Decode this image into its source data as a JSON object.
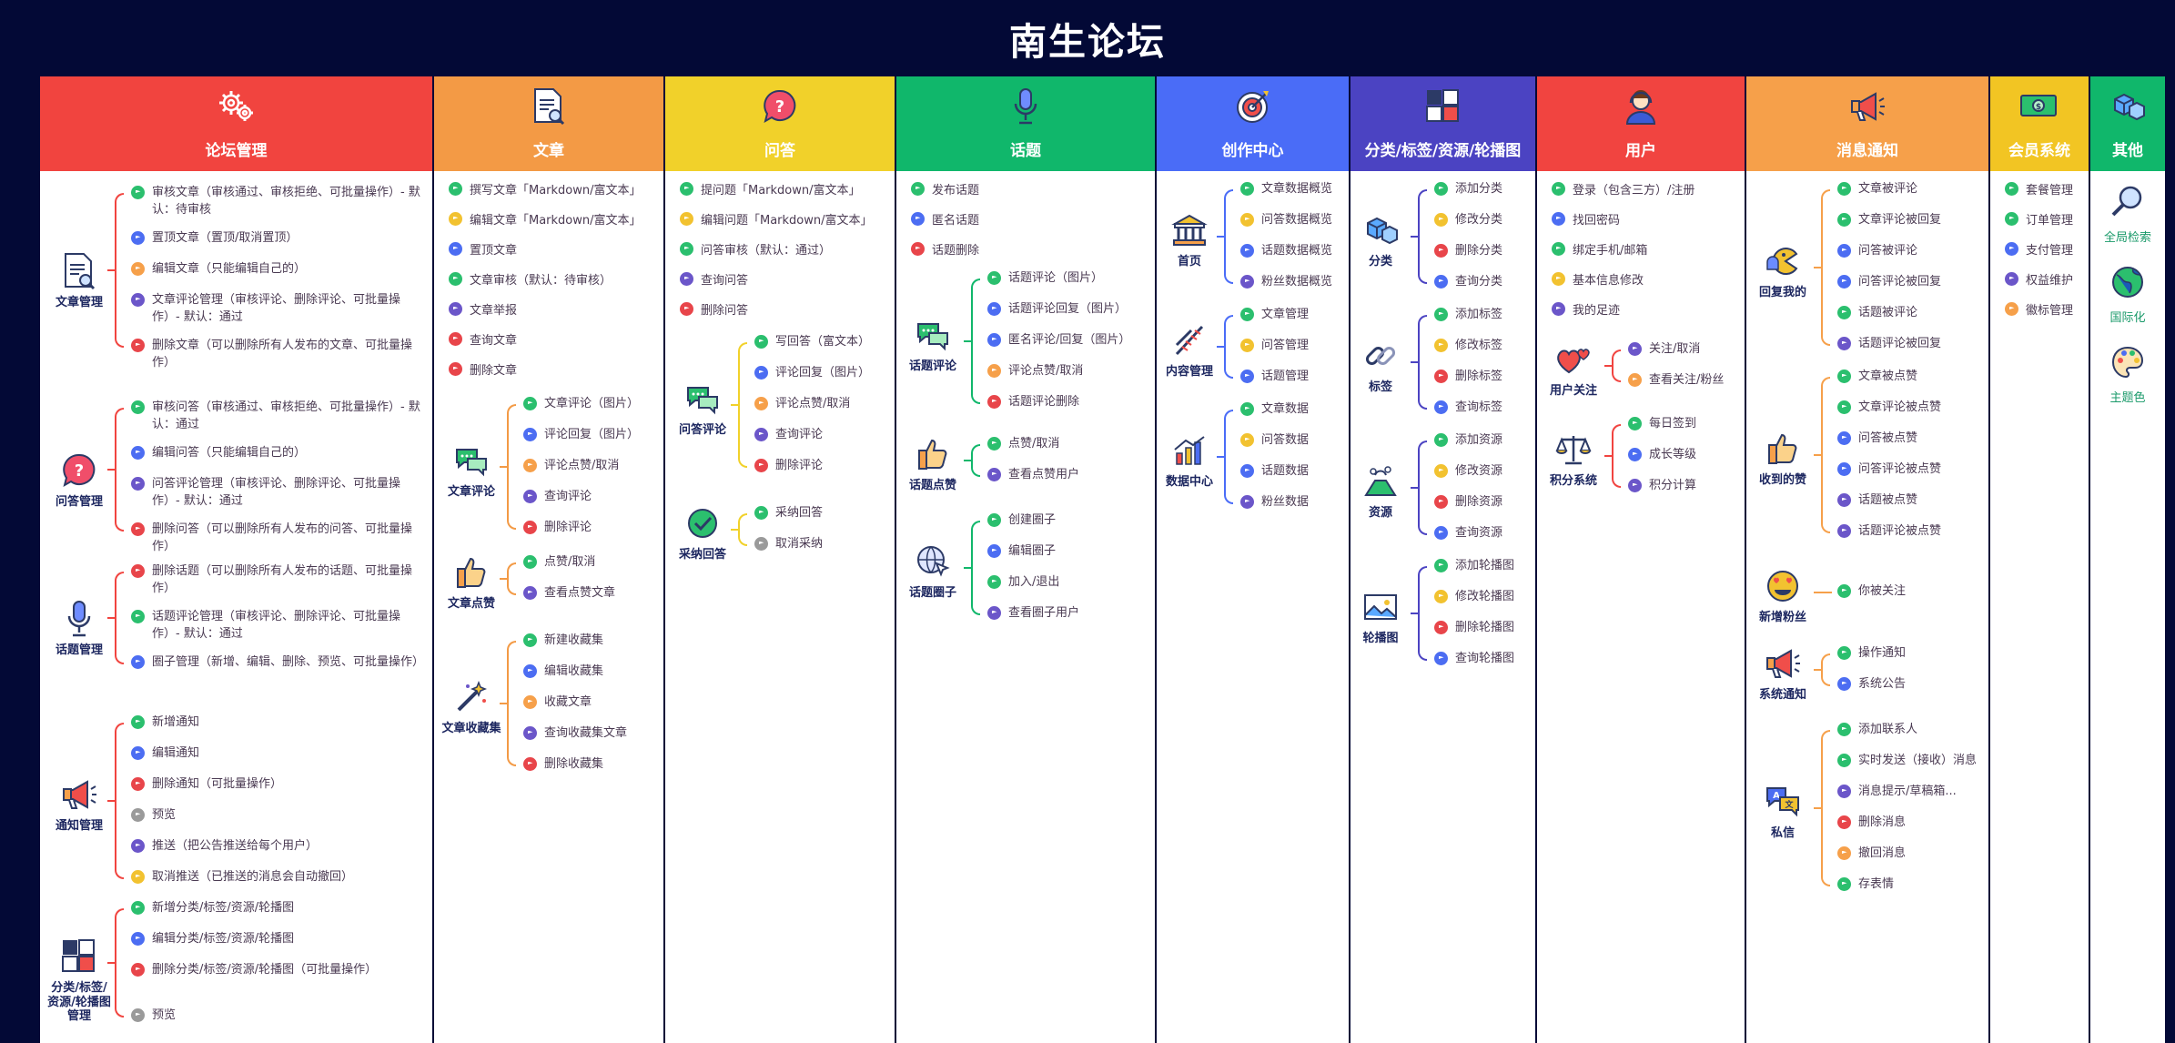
{
  "title": "南生论坛",
  "colors": {
    "bg": "#030936",
    "green": "#2bbf6e",
    "blue": "#4c6df2",
    "orange": "#f6a04a",
    "yellow": "#f2c230",
    "red": "#e8454a",
    "purple": "#6b56c9",
    "gray": "#9a9a9a"
  },
  "columns": [
    {
      "id": "forum",
      "title": "论坛管理",
      "color": "#f1443f",
      "icon": "gears-icon",
      "width": 431,
      "groups": [
        {
          "label": "文章管理",
          "icon": "document-search-icon",
          "items": [
            {
              "text": "审核文章（审核通过、审核拒绝、可批量操作）- 默认：待审核",
              "flag": "green"
            },
            {
              "text": "置顶文章（置顶/取消置顶）",
              "flag": "blue"
            },
            {
              "text": "编辑文章（只能编辑自己的）",
              "flag": "orange"
            },
            {
              "text": "文章评论管理（审核评论、删除评论、可批量操作）- 默认：通过",
              "flag": "purple"
            },
            {
              "text": "删除文章（可以删除所有人发布的文章、可批量操作）",
              "flag": "red"
            }
          ]
        },
        {
          "label": "问答管理",
          "icon": "question-bubble-icon",
          "items": [
            {
              "text": "审核问答（审核通过、审核拒绝、可批量操作）- 默认：通过",
              "flag": "green"
            },
            {
              "text": "编辑问答（只能编辑自己的）",
              "flag": "blue"
            },
            {
              "text": "问答评论管理（审核评论、删除评论、可批量操作）- 默认：通过",
              "flag": "purple"
            },
            {
              "text": "删除问答（可以删除所有人发布的问答、可批量操作）",
              "flag": "red"
            }
          ]
        },
        {
          "label": "话题管理",
          "icon": "microphone-icon",
          "items": [
            {
              "text": "删除话题（可以删除所有人发布的话题、可批量操作）",
              "flag": "red"
            },
            {
              "text": "话题评论管理（审核评论、删除评论、可批量操作）- 默认：通过",
              "flag": "green"
            },
            {
              "text": "圈子管理（新增、编辑、删除、预览、可批量操作）",
              "flag": "blue"
            }
          ]
        },
        {
          "label": "通知管理",
          "icon": "megaphone-icon",
          "items": [
            {
              "text": "新增通知",
              "flag": "green"
            },
            {
              "text": "编辑通知",
              "flag": "blue"
            },
            {
              "text": "删除通知（可批量操作）",
              "flag": "red"
            },
            {
              "text": "预览",
              "flag": "gray"
            },
            {
              "text": "推送（把公告推送给每个用户）",
              "flag": "purple"
            },
            {
              "text": "取消推送（已推送的消息会自动撤回）",
              "flag": "yellow"
            }
          ]
        },
        {
          "label": "分类/标签/资源/轮播图管理",
          "icon": "categories-icon",
          "items": [
            {
              "text": "新增分类/标签/资源/轮播图",
              "flag": "green"
            },
            {
              "text": "编辑分类/标签/资源/轮播图",
              "flag": "blue"
            },
            {
              "text": "删除分类/标签/资源/轮播图（可批量操作）",
              "flag": "red"
            },
            {
              "text": "预览",
              "flag": "gray"
            }
          ]
        }
      ]
    },
    {
      "id": "article",
      "title": "文章",
      "color": "#f39a45",
      "icon": "document-search-icon",
      "width": 252,
      "simple": [
        {
          "text": "撰写文章「Markdown/富文本」",
          "flag": "green"
        },
        {
          "text": "编辑文章「Markdown/富文本」",
          "flag": "yellow"
        },
        {
          "text": "置顶文章",
          "flag": "blue"
        },
        {
          "text": "文章审核（默认：待审核）",
          "flag": "green"
        },
        {
          "text": "文章举报",
          "flag": "purple"
        },
        {
          "text": "查询文章",
          "flag": "red"
        },
        {
          "text": "删除文章",
          "flag": "red"
        }
      ],
      "groups": [
        {
          "label": "文章评论",
          "icon": "chat-bubbles-icon",
          "items": [
            {
              "text": "文章评论（图片）",
              "flag": "green"
            },
            {
              "text": "评论回复（图片）",
              "flag": "blue"
            },
            {
              "text": "评论点赞/取消",
              "flag": "orange"
            },
            {
              "text": "查询评论",
              "flag": "purple"
            },
            {
              "text": "删除评论",
              "flag": "red"
            }
          ]
        },
        {
          "label": "文章点赞",
          "icon": "thumbs-up-icon",
          "items": [
            {
              "text": "点赞/取消",
              "flag": "green"
            },
            {
              "text": "查看点赞文章",
              "flag": "purple"
            }
          ]
        },
        {
          "label": "文章收藏集",
          "icon": "magic-wand-icon",
          "items": [
            {
              "text": "新建收藏集",
              "flag": "green"
            },
            {
              "text": "编辑收藏集",
              "flag": "blue"
            },
            {
              "text": "收藏文章",
              "flag": "orange"
            },
            {
              "text": "查询收藏集文章",
              "flag": "purple"
            },
            {
              "text": "删除收藏集",
              "flag": "red"
            }
          ]
        }
      ]
    },
    {
      "id": "qa",
      "title": "问答",
      "color": "#f1d12a",
      "icon": "question-bubble-icon",
      "width": 252,
      "simple": [
        {
          "text": "提问题「Markdown/富文本」",
          "flag": "green"
        },
        {
          "text": "编辑问题「Markdown/富文本」",
          "flag": "yellow"
        },
        {
          "text": "问答审核（默认：通过）",
          "flag": "green"
        },
        {
          "text": "查询问答",
          "flag": "purple"
        },
        {
          "text": "删除问答",
          "flag": "red"
        }
      ],
      "groups": [
        {
          "label": "问答评论",
          "icon": "chat-bubbles-icon",
          "items": [
            {
              "text": "写回答（富文本）",
              "flag": "green"
            },
            {
              "text": "评论回复（图片）",
              "flag": "blue"
            },
            {
              "text": "评论点赞/取消",
              "flag": "orange"
            },
            {
              "text": "查询评论",
              "flag": "purple"
            },
            {
              "text": "删除评论",
              "flag": "red"
            }
          ]
        },
        {
          "label": "采纳回答",
          "icon": "check-circle-icon",
          "items": [
            {
              "text": "采纳回答",
              "flag": "green"
            },
            {
              "text": "取消采纳",
              "flag": "gray"
            }
          ]
        }
      ]
    },
    {
      "id": "topic",
      "title": "话题",
      "color": "#10b76b",
      "icon": "microphone-icon",
      "width": 284,
      "simple": [
        {
          "text": "发布话题",
          "flag": "green"
        },
        {
          "text": "匿名话题",
          "flag": "blue"
        },
        {
          "text": "话题删除",
          "flag": "red"
        }
      ],
      "groups": [
        {
          "label": "话题评论",
          "icon": "chat-bubbles-icon",
          "items": [
            {
              "text": "话题评论（图片）",
              "flag": "green"
            },
            {
              "text": "话题评论回复（图片）",
              "flag": "blue"
            },
            {
              "text": "匿名评论/回复（图片）",
              "flag": "blue"
            },
            {
              "text": "评论点赞/取消",
              "flag": "orange"
            },
            {
              "text": "话题评论删除",
              "flag": "red"
            }
          ]
        },
        {
          "label": "话题点赞",
          "icon": "thumbs-up-icon",
          "items": [
            {
              "text": "点赞/取消",
              "flag": "green"
            },
            {
              "text": "查看点赞用户",
              "flag": "purple"
            }
          ]
        },
        {
          "label": "话题圈子",
          "icon": "globe-cursor-icon",
          "items": [
            {
              "text": "创建圈子",
              "flag": "green"
            },
            {
              "text": "编辑圈子",
              "flag": "blue"
            },
            {
              "text": "加入/退出",
              "flag": "green"
            },
            {
              "text": "查看圈子用户",
              "flag": "purple"
            }
          ]
        }
      ]
    },
    {
      "id": "creator",
      "title": "创作中心",
      "color": "#4a6cf7",
      "icon": "target-icon",
      "width": 211,
      "groups": [
        {
          "label": "首页",
          "icon": "bank-icon",
          "items": [
            {
              "text": "文章数据概览",
              "flag": "green"
            },
            {
              "text": "问答数据概览",
              "flag": "yellow"
            },
            {
              "text": "话题数据概览",
              "flag": "blue"
            },
            {
              "text": "粉丝数据概览",
              "flag": "purple"
            }
          ]
        },
        {
          "label": "内容管理",
          "icon": "dna-icon",
          "items": [
            {
              "text": "文章管理",
              "flag": "green"
            },
            {
              "text": "问答管理",
              "flag": "yellow"
            },
            {
              "text": "话题管理",
              "flag": "blue"
            }
          ]
        },
        {
          "label": "数据中心",
          "icon": "bar-chart-icon",
          "items": [
            {
              "text": "文章数据",
              "flag": "green"
            },
            {
              "text": "问答数据",
              "flag": "yellow"
            },
            {
              "text": "话题数据",
              "flag": "blue"
            },
            {
              "text": "粉丝数据",
              "flag": "purple"
            }
          ]
        }
      ]
    },
    {
      "id": "category",
      "title": "分类/标签/资源/轮播图",
      "color": "#4b43c2",
      "icon": "categories-icon",
      "width": 203,
      "groups": [
        {
          "label": "分类",
          "icon": "cubes-icon",
          "items": [
            {
              "text": "添加分类",
              "flag": "green"
            },
            {
              "text": "修改分类",
              "flag": "yellow"
            },
            {
              "text": "删除分类",
              "flag": "red"
            },
            {
              "text": "查询分类",
              "flag": "blue"
            }
          ]
        },
        {
          "label": "标签",
          "icon": "link-icon",
          "items": [
            {
              "text": "添加标签",
              "flag": "green"
            },
            {
              "text": "修改标签",
              "flag": "yellow"
            },
            {
              "text": "删除标签",
              "flag": "red"
            },
            {
              "text": "查询标签",
              "flag": "blue"
            }
          ]
        },
        {
          "label": "资源",
          "icon": "volcano-icon",
          "items": [
            {
              "text": "添加资源",
              "flag": "green"
            },
            {
              "text": "修改资源",
              "flag": "yellow"
            },
            {
              "text": "删除资源",
              "flag": "red"
            },
            {
              "text": "查询资源",
              "flag": "blue"
            }
          ]
        },
        {
          "label": "轮播图",
          "icon": "picture-icon",
          "items": [
            {
              "text": "添加轮播图",
              "flag": "green"
            },
            {
              "text": "修改轮播图",
              "flag": "yellow"
            },
            {
              "text": "删除轮播图",
              "flag": "red"
            },
            {
              "text": "查询轮播图",
              "flag": "blue"
            }
          ]
        }
      ]
    },
    {
      "id": "user",
      "title": "用户",
      "color": "#f14440",
      "icon": "user-headset-icon",
      "width": 228,
      "simple": [
        {
          "text": "登录（包含三方）/注册",
          "flag": "green"
        },
        {
          "text": "找回密码",
          "flag": "blue"
        },
        {
          "text": "绑定手机/邮箱",
          "flag": "green"
        },
        {
          "text": "基本信息修改",
          "flag": "yellow"
        },
        {
          "text": "我的足迹",
          "flag": "purple"
        }
      ],
      "groups": [
        {
          "label": "用户关注",
          "icon": "hearts-icon",
          "items": [
            {
              "text": "关注/取消",
              "flag": "purple"
            },
            {
              "text": "查看关注/粉丝",
              "flag": "orange"
            }
          ]
        },
        {
          "label": "积分系统",
          "icon": "scales-icon",
          "items": [
            {
              "text": "每日签到",
              "flag": "green"
            },
            {
              "text": "成长等级",
              "flag": "blue"
            },
            {
              "text": "积分计算",
              "flag": "purple"
            }
          ]
        }
      ]
    },
    {
      "id": "message",
      "title": "消息通知",
      "color": "#f6a04a",
      "icon": "megaphone-icon",
      "width": 266,
      "groups": [
        {
          "label": "回复我的",
          "icon": "pacman-icon",
          "items": [
            {
              "text": "文章被评论",
              "flag": "green"
            },
            {
              "text": "文章评论被回复",
              "flag": "green"
            },
            {
              "text": "问答被评论",
              "flag": "blue"
            },
            {
              "text": "问答评论被回复",
              "flag": "blue"
            },
            {
              "text": "话题被评论",
              "flag": "green"
            },
            {
              "text": "话题评论被回复",
              "flag": "purple"
            }
          ]
        },
        {
          "label": "收到的赞",
          "icon": "thumbs-up-icon",
          "items": [
            {
              "text": "文章被点赞",
              "flag": "green"
            },
            {
              "text": "文章评论被点赞",
              "flag": "green"
            },
            {
              "text": "问答被点赞",
              "flag": "blue"
            },
            {
              "text": "问答评论被点赞",
              "flag": "blue"
            },
            {
              "text": "话题被点赞",
              "flag": "purple"
            },
            {
              "text": "话题评论被点赞",
              "flag": "purple"
            }
          ]
        },
        {
          "label": "新增粉丝",
          "icon": "heart-eyes-icon",
          "items": [
            {
              "text": "你被关注",
              "flag": "green"
            }
          ]
        },
        {
          "label": "系统通知",
          "icon": "megaphone-icon",
          "items": [
            {
              "text": "操作通知",
              "flag": "green"
            },
            {
              "text": "系统公告",
              "flag": "blue"
            }
          ]
        },
        {
          "label": "私信",
          "icon": "translate-bubbles-icon",
          "items": [
            {
              "text": "添加联系人",
              "flag": "green"
            },
            {
              "text": "实时发送（接收）消息",
              "flag": "green"
            },
            {
              "text": "消息提示/草稿箱...",
              "flag": "purple"
            },
            {
              "text": "删除消息",
              "flag": "red"
            },
            {
              "text": "撤回消息",
              "flag": "orange"
            },
            {
              "text": "存表情",
              "flag": "green"
            }
          ]
        }
      ]
    },
    {
      "id": "member",
      "title": "会员系统",
      "color": "#f2c523",
      "icon": "cash-icon",
      "width": 108,
      "simple": [
        {
          "text": "套餐管理",
          "flag": "green"
        },
        {
          "text": "订单管理",
          "flag": "green"
        },
        {
          "text": "支付管理",
          "flag": "blue"
        },
        {
          "text": "权益维护",
          "flag": "purple"
        },
        {
          "text": "徽标管理",
          "flag": "orange"
        }
      ]
    },
    {
      "id": "other",
      "title": "其他",
      "color": "#10b76b",
      "icon": "cubes-icon",
      "width": 82,
      "tiles": [
        {
          "text": "全局检索",
          "icon": "magnifier-icon"
        },
        {
          "text": "国际化",
          "icon": "globe-icon"
        },
        {
          "text": "主题色",
          "icon": "palette-icon"
        }
      ]
    }
  ]
}
